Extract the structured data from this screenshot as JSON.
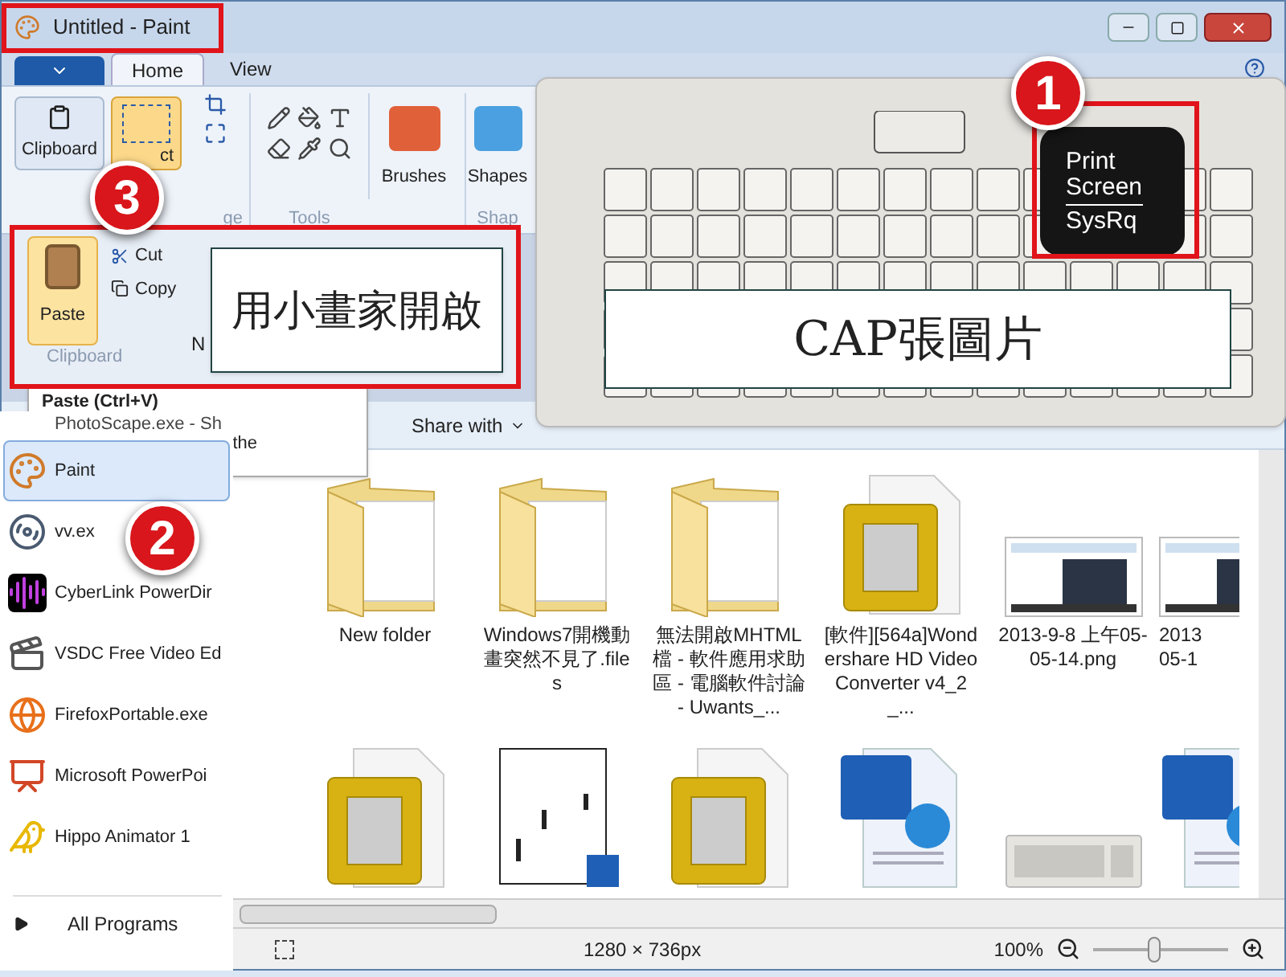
{
  "window": {
    "title": "Untitled - Paint"
  },
  "ribbon": {
    "tabs": [
      {
        "label": "Home",
        "selected": true
      },
      {
        "label": "View",
        "selected": false
      }
    ],
    "clipboard_button": "Clipboard",
    "select": {
      "label": "ct",
      "selected": true
    },
    "image_group": "ge",
    "tools_group": "Tools",
    "brushes_button": "Brushes",
    "shapes_button": "Shapes",
    "shapes_group": "Shap"
  },
  "keyboard": {
    "badge": "1",
    "key_lines": [
      "Print",
      "Screen",
      "SysRq"
    ],
    "callout": "CAP張圖片"
  },
  "clipboard_popup": {
    "badge": "3",
    "paste": "Paste",
    "cut": "Cut",
    "copy": "Copy",
    "group_label": "Clipboard",
    "partial": "N",
    "callout": "用小畫家開啟",
    "tooltip": "Paste (Ctrl+V)",
    "tooltip_extra": "the"
  },
  "start_menu": {
    "badge": "2",
    "top_item": "PhotoScape.exe - Sh",
    "items": [
      {
        "label": "Paint",
        "kind": "paint",
        "selected": true
      },
      {
        "label": "vv.ex",
        "kind": "video",
        "selected": false
      },
      {
        "label": "CyberLink PowerDir",
        "kind": "cyberlink",
        "selected": false
      },
      {
        "label": "VSDC Free Video Ed",
        "kind": "clapper",
        "selected": false
      },
      {
        "label": "FirefoxPortable.exe",
        "kind": "browser",
        "selected": false
      },
      {
        "label": "Microsoft PowerPoi",
        "kind": "slides",
        "selected": false
      },
      {
        "label": "Hippo Animator 1",
        "kind": "chick",
        "selected": false
      }
    ],
    "all_programs": "All Programs"
  },
  "explorer": {
    "toolbar": [
      "Share with"
    ],
    "files": [
      {
        "name": "New folder",
        "kind": "folder"
      },
      {
        "name": "Windows7開機動畫突然不見了.files",
        "kind": "folder"
      },
      {
        "name": "無法開啟MHTML檔 - 軟件應用求助區 - 電腦軟件討論 - Uwants_...",
        "kind": "folder"
      },
      {
        "name": "[軟件][564a]Wondershare HD Video Converter v4_2_...",
        "kind": "image"
      },
      {
        "name": "2013-9-8 上午05-05-14.png",
        "kind": "screenshot"
      },
      {
        "name": "2013 05-1",
        "kind": "screenshot"
      }
    ],
    "files_row_2": [
      {
        "kind": "image"
      },
      {
        "kind": "document"
      },
      {
        "kind": "image"
      },
      {
        "kind": "word"
      },
      {
        "kind": "keyboard"
      },
      {
        "kind": "word"
      }
    ]
  },
  "status_bar": {
    "size": "1280 × 736px",
    "zoom": "100%",
    "level": 0.45
  }
}
